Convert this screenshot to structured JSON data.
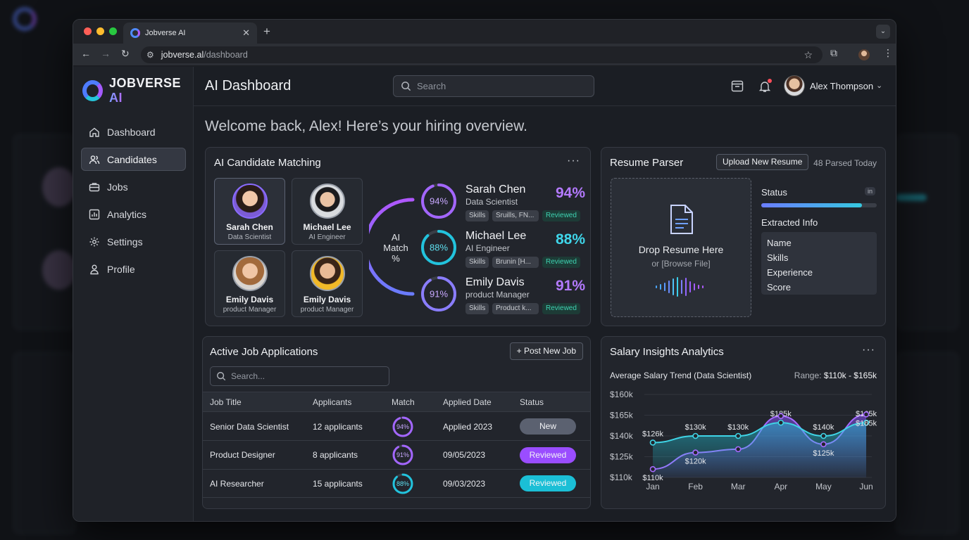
{
  "browser": {
    "tab_title": "Jobverse AI",
    "url_host": "jobverse.al",
    "url_path": "/dashboard"
  },
  "brand": {
    "name": "JOBVERSE",
    "suffix": "AI"
  },
  "header": {
    "title": "AI Dashboard",
    "search_placeholder": "Search",
    "user_name": "Alex Thompson"
  },
  "sidebar": {
    "items": [
      {
        "label": "Dashboard",
        "icon": "home-icon"
      },
      {
        "label": "Candidates",
        "icon": "users-icon"
      },
      {
        "label": "Jobs",
        "icon": "briefcase-icon"
      },
      {
        "label": "Analytics",
        "icon": "chart-icon"
      },
      {
        "label": "Settings",
        "icon": "gear-icon"
      },
      {
        "label": "Profile",
        "icon": "user-icon"
      }
    ],
    "active_index": 1
  },
  "welcome": "Welcome back, Alex! Here’s your hiring overview.",
  "matching": {
    "title": "AI Candidate Matching",
    "arc_label_1": "AI",
    "arc_label_2": "Match",
    "arc_label_3": "%",
    "cards": [
      {
        "name": "Sarah Chen",
        "role": "Data Scientist"
      },
      {
        "name": "Michael Lee",
        "role": "AI Engineer"
      },
      {
        "name": "Emily Davis",
        "role": "product Manager"
      },
      {
        "name": "Emily Davis",
        "role": "product Manager"
      }
    ],
    "rows": [
      {
        "name": "Sarah Chen",
        "role": "Data Scientist",
        "pct_label": "94%",
        "pct": 94,
        "chip1": "Skills",
        "chip2": "Sruills, FN...",
        "status": "Reviewed",
        "color": "#a366ff"
      },
      {
        "name": "Michael Lee",
        "role": "AI Engineer",
        "pct_label": "88%",
        "pct": 88,
        "chip1": "Skills",
        "chip2": "Brunin [H...",
        "status": "Reviewed",
        "color": "#22c3dd"
      },
      {
        "name": "Emily Davis",
        "role": "product Manager",
        "pct_label": "91%",
        "pct": 91,
        "chip1": "Skills",
        "chip2": "Product k...",
        "status": "Reviewed",
        "color": "#8a7dff"
      }
    ]
  },
  "resume": {
    "title": "Resume Parser",
    "upload_label": "Upload New Resume",
    "parsed_today": "48 Parsed Today",
    "drop_title": "Drop Resume Here",
    "drop_sub": "or [Browse File]",
    "status_label": "Status",
    "status_badge": "in",
    "progress": 0.87,
    "extracted_label": "Extracted Info",
    "extracted": [
      "Name",
      "Skills",
      "Experience",
      "Score"
    ]
  },
  "jobs": {
    "title": "Active Job Applications",
    "post_label": "Post New Job",
    "search_placeholder": "Search...",
    "columns": [
      "Job Title",
      "Applicants",
      "Match",
      "Applied Date",
      "Status"
    ],
    "rows": [
      {
        "title": "Senior Data Scientist",
        "applicants": "12 applicants",
        "match_label": "94%",
        "match": 94,
        "date": "Applied 2023",
        "status": "New",
        "status_bg": "#5b6170",
        "match_color": "#a366ff"
      },
      {
        "title": "Product Designer",
        "applicants": "8 applicants",
        "match_label": "91%",
        "match": 91,
        "date": "09/05/2023",
        "status": "Reviewed",
        "status_bg": "#9a4dff",
        "match_color": "#a366ff"
      },
      {
        "title": "AI Researcher",
        "applicants": "15 applicants",
        "match_label": "88%",
        "match": 88,
        "date": "09/03/2023",
        "status": "Reviewed",
        "status_bg": "#1bbfd6",
        "match_color": "#22c3dd"
      }
    ]
  },
  "salary": {
    "title": "Salary Insights Analytics",
    "subtitle": "Average Salary Trend (Data Scientist)",
    "range_label": "Range:",
    "range_value": "$110k - $165k"
  },
  "chart_data": {
    "type": "line",
    "title": "Average Salary Trend (Data Scientist)",
    "categories": [
      "Jan",
      "Feb",
      "Mar",
      "Apr",
      "May",
      "Jun"
    ],
    "y_tick_labels": [
      "$160k",
      "$165k",
      "$140k",
      "$125k",
      "$110k"
    ],
    "series": [
      {
        "values": [
          126,
          130,
          130,
          138,
          130,
          138
        ],
        "labels": [
          "$126k",
          "$130k",
          "$130k",
          "$185k",
          "$140k",
          "$165k"
        ],
        "color": "#3fd4e6"
      },
      {
        "values": [
          110,
          120,
          122,
          142,
          125,
          143
        ],
        "labels": [
          "$110k",
          "$120k",
          "",
          "",
          "$125k",
          "$165k"
        ],
        "color": "#a66bff"
      }
    ],
    "ylim": [
      105,
      155
    ],
    "grid": true
  }
}
